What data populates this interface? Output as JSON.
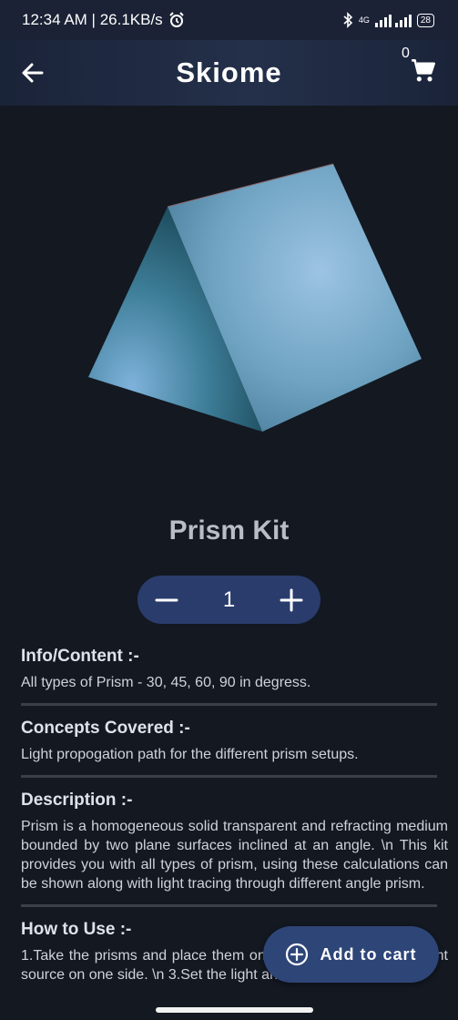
{
  "status_bar": {
    "left_text": "12:34 AM | 26.1KB/s",
    "network": "4G",
    "battery": "28"
  },
  "app_bar": {
    "title": "Skiome",
    "cart_count": "0"
  },
  "product": {
    "name": "Prism Kit",
    "quantity": "1",
    "decrement_symbol": "−",
    "increment_symbol": "+"
  },
  "sections": [
    {
      "title": "Info/Content :-",
      "body": "All types of Prism - 30, 45, 60, 90 in degress."
    },
    {
      "title": "Concepts Covered :-",
      "body": "Light propogation path for the different prism setups."
    },
    {
      "title": "Description :-",
      "body": "Prism is a homogeneous solid transparent and refracting medium bounded by two plane surfaces inclined at an angle. \\n This kit provides  you with all types of prism, using these calculations can be shown along with light tracing through different angle prism."
    },
    {
      "title": "How to Use :-",
      "body": "1.Take the prisms and place them on the table. \\n 2.Place a light source on one side. \\n 3.Set the light and get the"
    }
  ],
  "fab": {
    "label": "Add to cart"
  },
  "icons": [
    "back-arrow-icon",
    "cart-icon",
    "minus-icon",
    "plus-icon",
    "add-circle-icon",
    "alarm-icon",
    "bluetooth-icon",
    "signal-icon",
    "battery-icon"
  ]
}
